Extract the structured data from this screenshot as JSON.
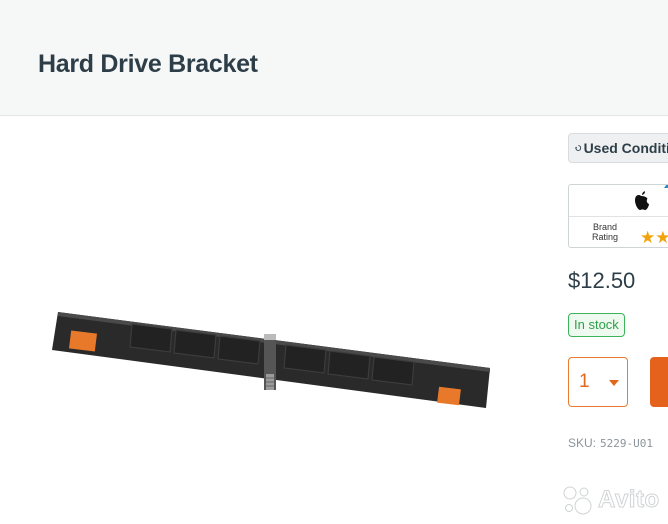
{
  "header": {
    "title": "Hard Drive Bracket"
  },
  "product": {
    "condition_badge": "Used Condition",
    "brand": {
      "name_icon": "apple-icon",
      "label": "Brand Rating",
      "stars": "★★"
    },
    "price": "$12.50",
    "stock": "In stock",
    "quantity": "1",
    "sku_label": "SKU:",
    "sku_value": "5229-U01"
  },
  "watermark": {
    "text": "Avito"
  },
  "colors": {
    "accent": "#e5621c",
    "stock_green": "#3cb35a",
    "star": "#f0a30a"
  }
}
